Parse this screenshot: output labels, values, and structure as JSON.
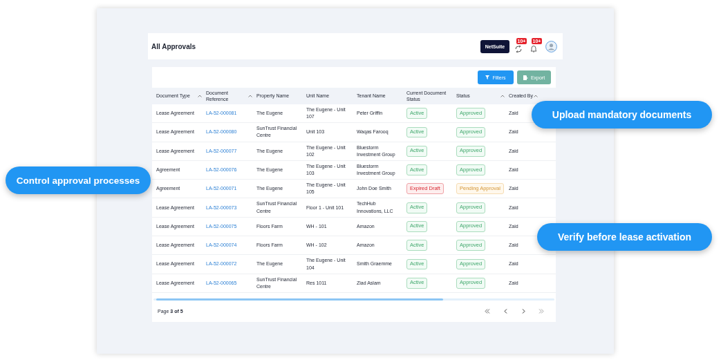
{
  "header": {
    "title": "All Approvals",
    "netsuite_button": "NetSuite",
    "approvals_badge": "10+",
    "notifications_badge": "10+"
  },
  "toolbar": {
    "filters_button": "Filters",
    "export_button": "Export"
  },
  "table": {
    "columns": [
      {
        "label": "Document Type",
        "sortable": true
      },
      {
        "label": "Document Reference",
        "sortable": true
      },
      {
        "label": "Property Name",
        "sortable": false
      },
      {
        "label": "Unit Name",
        "sortable": false
      },
      {
        "label": "Tenant Name",
        "sortable": false
      },
      {
        "label": "Current Document Status",
        "sortable": false
      },
      {
        "label": "Status",
        "sortable": true
      },
      {
        "label": "Created By",
        "sortable": true
      }
    ],
    "rows": [
      {
        "document_type": "Lease Agreement",
        "reference": "LA-52-000081",
        "property": "The Eugene",
        "unit": "The Eugene - Unit 107",
        "tenant": "Peter Griffin",
        "document_status": {
          "text": "Active",
          "kind": "success"
        },
        "status": {
          "text": "Approved",
          "kind": "success"
        },
        "created_by": "Zaid"
      },
      {
        "document_type": "Lease Agreement",
        "reference": "LA-52-000080",
        "property": "SunTrust Financial Centre",
        "unit": "Unit 103",
        "tenant": "Waqas Farooq",
        "document_status": {
          "text": "Active",
          "kind": "success"
        },
        "status": {
          "text": "Approved",
          "kind": "success"
        },
        "created_by": "Zaid"
      },
      {
        "document_type": "Lease Agreement",
        "reference": "LA-52-000077",
        "property": "The Eugene",
        "unit": "The Eugene - Unit 102",
        "tenant": "Bluestorm Investment Group",
        "document_status": {
          "text": "Active",
          "kind": "success"
        },
        "status": {
          "text": "Approved",
          "kind": "success"
        },
        "created_by": "Zaid"
      },
      {
        "document_type": "Agreement",
        "reference": "LA-52-000076",
        "property": "The Eugene",
        "unit": "The Eugene - Unit 103",
        "tenant": "Bluestorm Investment Group",
        "document_status": {
          "text": "Active",
          "kind": "success"
        },
        "status": {
          "text": "Approved",
          "kind": "success"
        },
        "created_by": "Zaid"
      },
      {
        "document_type": "Agreement",
        "reference": "LA-52-000071",
        "property": "The Eugene",
        "unit": "The Eugene - Unit 105",
        "tenant": "John Doe Smith",
        "document_status": {
          "text": "Expired Draft",
          "kind": "danger"
        },
        "status": {
          "text": "Pending Approval",
          "kind": "warning"
        },
        "created_by": "Zaid"
      },
      {
        "document_type": "Lease Agreement",
        "reference": "LA-52-000073",
        "property": "SunTrust Financial Centre",
        "unit": "Floor 1 - Unit 101",
        "tenant": "TechHub Innovations, LLC",
        "document_status": {
          "text": "Active",
          "kind": "success"
        },
        "status": {
          "text": "Approved",
          "kind": "success"
        },
        "created_by": "Zaid"
      },
      {
        "document_type": "Lease Agreement",
        "reference": "LA-52-000075",
        "property": "Floors Farm",
        "unit": "WH - 101",
        "tenant": "Amazon",
        "document_status": {
          "text": "Active",
          "kind": "success"
        },
        "status": {
          "text": "Approved",
          "kind": "success"
        },
        "created_by": "Zaid"
      },
      {
        "document_type": "Lease Agreement",
        "reference": "LA-52-000074",
        "property": "Floors Farm",
        "unit": "WH - 102",
        "tenant": "Amazon",
        "document_status": {
          "text": "Active",
          "kind": "success"
        },
        "status": {
          "text": "Approved",
          "kind": "success"
        },
        "created_by": "Zaid"
      },
      {
        "document_type": "Lease Agreement",
        "reference": "LA-52-000072",
        "property": "The Eugene",
        "unit": "The Eugene - Unit 104",
        "tenant": "Smith Graemme",
        "document_status": {
          "text": "Active",
          "kind": "success"
        },
        "status": {
          "text": "Approved",
          "kind": "success"
        },
        "created_by": "Zaid"
      },
      {
        "document_type": "Lease Agreement",
        "reference": "LA-52-000065",
        "property": "SunTrust Financial Centre",
        "unit": "Res 1011",
        "tenant": "Ziad Aslam",
        "document_status": {
          "text": "Active",
          "kind": "success"
        },
        "status": {
          "text": "Approved",
          "kind": "success"
        },
        "created_by": "Zaid"
      }
    ]
  },
  "pagination": {
    "label": "Page **3 of 5**"
  },
  "callouts": [
    {
      "text": "Upload mandatory documents"
    },
    {
      "text": "Control approval processes"
    },
    {
      "text": "Verify before lease activation"
    }
  ]
}
